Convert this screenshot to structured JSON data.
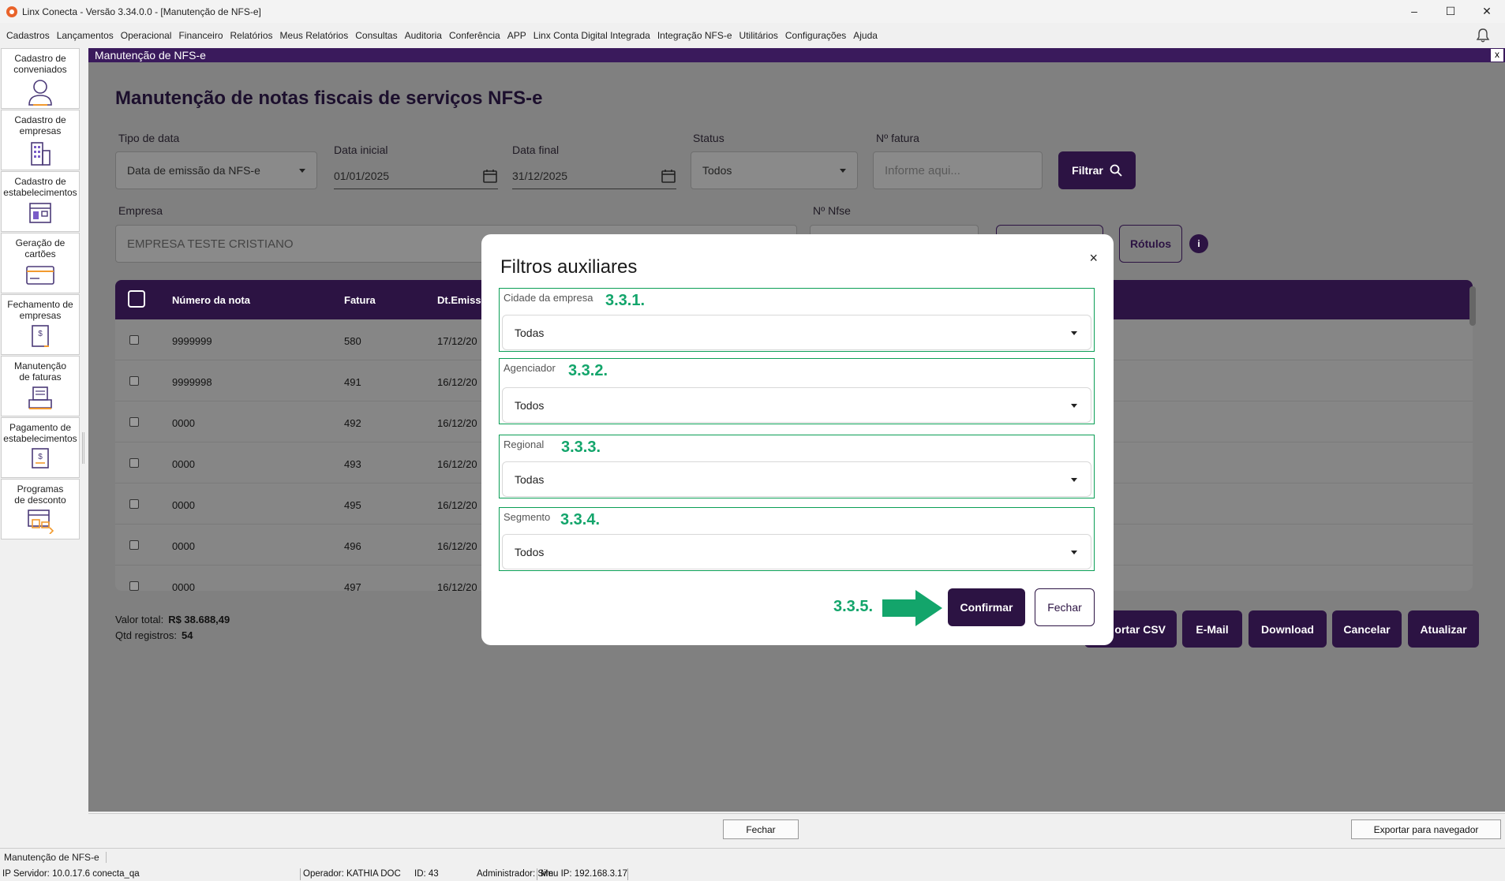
{
  "window": {
    "title": "Linx Conecta - Versão 3.34.0.0 - [Manutenção de NFS-e]"
  },
  "menu": [
    "Cadastros",
    "Lançamentos",
    "Operacional",
    "Financeiro",
    "Relatórios",
    "Meus Relatórios",
    "Consultas",
    "Auditoria",
    "Conferência",
    "APP",
    "Linx Conta Digital Integrada",
    "Integração NFS-e",
    "Utilitários",
    "Configurações",
    "Ajuda"
  ],
  "sidebar": {
    "items": [
      {
        "label1": "Cadastro de",
        "label2": "conveniados"
      },
      {
        "label1": "Cadastro de",
        "label2": "empresas"
      },
      {
        "label1": "Cadastro de",
        "label2": "estabelecimentos"
      },
      {
        "label1": "Geração de",
        "label2": "cartões"
      },
      {
        "label1": "Fechamento de",
        "label2": "empresas"
      },
      {
        "label1": "Manutenção",
        "label2": "de faturas"
      },
      {
        "label1": "Pagamento de",
        "label2": "estabelecimentos"
      },
      {
        "label1": "Programas",
        "label2": "de desconto"
      }
    ]
  },
  "child": {
    "title": "Manutenção de NFS-e",
    "close": "x"
  },
  "page": {
    "heading": "Manutenção de notas fiscais de serviços NFS-e",
    "tipo_data": {
      "label": "Tipo de data",
      "value": "Data de emissão da NFS-e"
    },
    "data_inicial": {
      "label": "Data inicial",
      "value": "01/01/2025"
    },
    "data_final": {
      "label": "Data final",
      "value": "31/12/2025"
    },
    "status": {
      "label": "Status",
      "value": "Todos"
    },
    "fatura": {
      "label": "Nº fatura",
      "placeholder": "Informe aqui..."
    },
    "filtrar": "Filtrar",
    "empresa": {
      "label": "Empresa",
      "value": "EMPRESA TESTE CRISTIANO"
    },
    "nfse": {
      "label": "Nº Nfse"
    },
    "rotulos": "Rótulos",
    "info": "i"
  },
  "table": {
    "columns": [
      "Número da nota",
      "Fatura",
      "Dt.Emissã"
    ],
    "rows": [
      [
        "9999999",
        "580",
        "17/12/20"
      ],
      [
        "9999998",
        "491",
        "16/12/20"
      ],
      [
        "0000",
        "492",
        "16/12/20"
      ],
      [
        "0000",
        "493",
        "16/12/20"
      ],
      [
        "0000",
        "495",
        "16/12/20"
      ],
      [
        "0000",
        "496",
        "16/12/20"
      ],
      [
        "0000",
        "497",
        "16/12/20"
      ]
    ]
  },
  "totals": {
    "valor_label": "Valor total:",
    "valor": "R$ 38.688,49",
    "qtd_label": "Qtd registros:",
    "qtd": "54"
  },
  "actions": [
    "ortar CSV",
    "E-Mail",
    "Download",
    "Cancelar",
    "Atualizar"
  ],
  "modal": {
    "title": "Filtros auxiliares",
    "close": "×",
    "filters": [
      {
        "label": "Cidade da empresa",
        "value": "Todas",
        "step": "3.3.1."
      },
      {
        "label": "Agenciador",
        "value": "Todos",
        "step": "3.3.2."
      },
      {
        "label": "Regional",
        "value": "Todas",
        "step": "3.3.3."
      },
      {
        "label": "Segmento",
        "value": "Todos",
        "step": "3.3.4."
      }
    ],
    "step_confirm": "3.3.5.",
    "confirm": "Confirmar",
    "fechar": "Fechar"
  },
  "bottom": {
    "fechar": "Fechar",
    "exportar": "Exportar para navegador"
  },
  "tab": "Manutenção de NFS-e",
  "status": {
    "server": "IP Servidor: 10.0.17.6 conecta_qa",
    "operador": "Operador: KATHIA DOC",
    "id": "ID: 43",
    "admin": "Administrador: Sim",
    "ip": "Meu IP: 192.168.3.17"
  },
  "colors": {
    "primary": "#2c1343",
    "annotation": "#13a56b",
    "app_icon": "#e9632a"
  }
}
